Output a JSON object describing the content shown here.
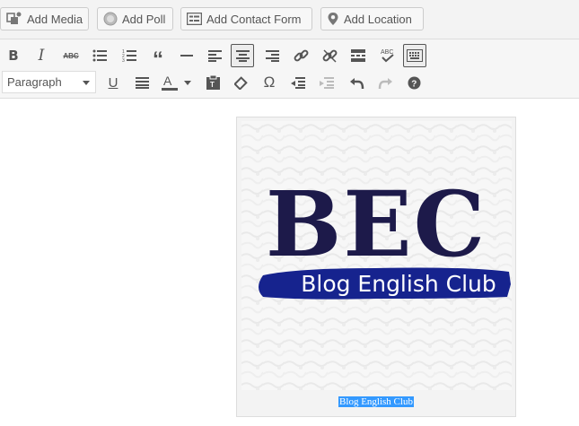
{
  "media_buttons": [
    {
      "label": "Add Media",
      "icon": "add-media-icon"
    },
    {
      "label": "Add Poll",
      "icon": "poll-icon"
    },
    {
      "label": "Add Contact Form",
      "icon": "contact-form-icon"
    },
    {
      "label": "Add Location",
      "icon": "location-pin-icon"
    }
  ],
  "toolbar": {
    "row1": [
      "bold",
      "italic",
      "strikethrough",
      "bulleted-list",
      "numbered-list",
      "blockquote",
      "horizontal-line",
      "align-left",
      "align-center",
      "align-right",
      "insert-link",
      "remove-link",
      "read-more",
      "spellcheck",
      "toolbar-toggle"
    ],
    "active": "align-center",
    "format_select": {
      "value": "Paragraph"
    },
    "row2": [
      "underline",
      "justify",
      "text-color",
      "paste-as-text",
      "clear-formatting",
      "special-character",
      "outdent",
      "indent",
      "undo",
      "redo",
      "help"
    ],
    "text_color_swatch": "#555555"
  },
  "image": {
    "logo_text": "BEC",
    "banner_text": "Blog English Club",
    "ink_color": "#1d1a4a",
    "banner_color": "#16238e"
  },
  "caption": {
    "text": "Blog English Club"
  }
}
